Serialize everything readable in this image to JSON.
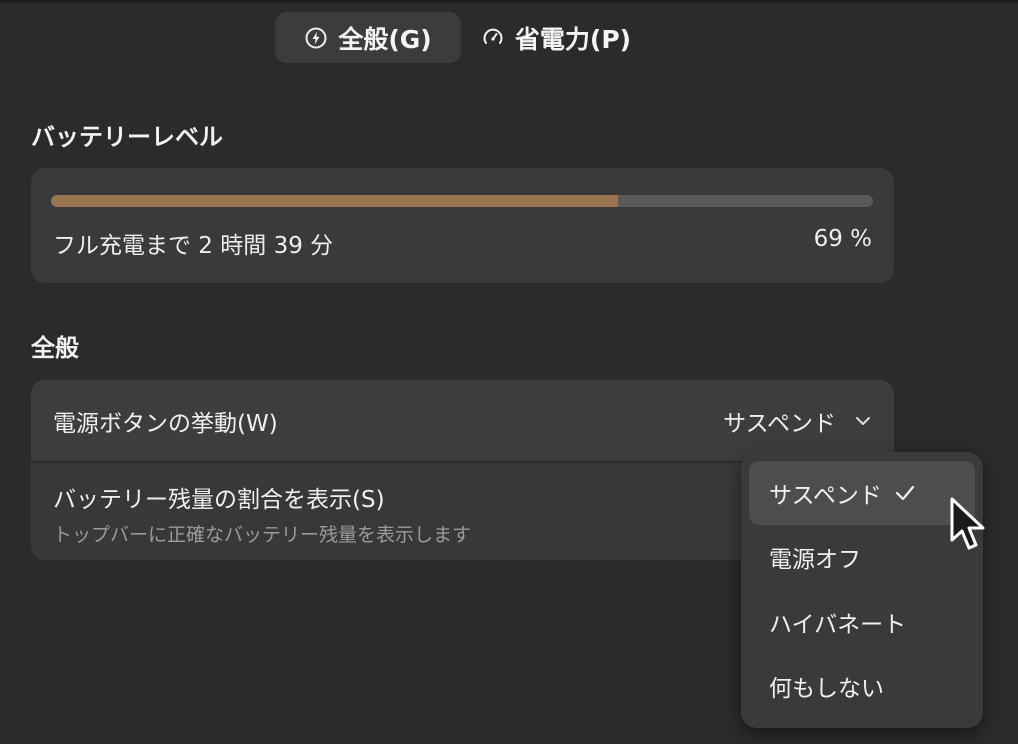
{
  "tabs": [
    {
      "label": "全般(G)",
      "icon": "power-icon",
      "active": true
    },
    {
      "label": "省電力(P)",
      "icon": "gauge-icon",
      "active": false
    }
  ],
  "battery": {
    "section_title": "バッテリーレベル",
    "status_text": "フル充電まで 2 時間 39 分",
    "percent_text": "69 %",
    "level_fraction": 0.69
  },
  "general": {
    "section_title": "全般",
    "power_button": {
      "label": "電源ボタンの挙動(W)",
      "value": "サスペンド"
    },
    "show_percentage": {
      "label": "バッテリー残量の割合を表示(S)",
      "subtitle": "トップバーに正確なバッテリー残量を表示します"
    }
  },
  "dropdown": {
    "options": [
      {
        "label": "サスペンド",
        "selected": true
      },
      {
        "label": "電源オフ",
        "selected": false
      },
      {
        "label": "ハイバネート",
        "selected": false
      },
      {
        "label": "何もしない",
        "selected": false
      }
    ]
  },
  "colors": {
    "background": "#2b2b2b",
    "card": "#3a3a3a",
    "progress_fill": "#9b7452",
    "progress_track": "#5a5a5a"
  }
}
